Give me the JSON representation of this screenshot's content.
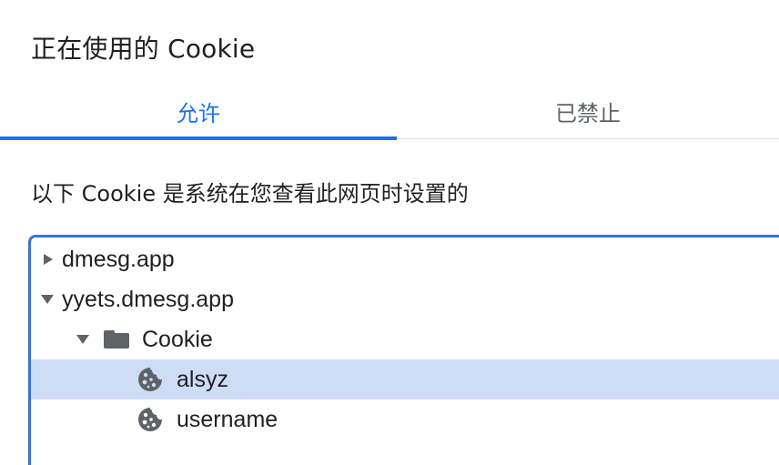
{
  "dialog": {
    "title": "正在使用的 Cookie",
    "tabs": [
      {
        "label": "允许",
        "active": true
      },
      {
        "label": "已禁止",
        "active": false
      }
    ],
    "description": "以下 Cookie 是系统在您查看此网页时设置的"
  },
  "tree": {
    "items": [
      {
        "label": "dmesg.app",
        "level": 0,
        "expanded": false,
        "icon": "triangle-right-icon"
      },
      {
        "label": "yyets.dmesg.app",
        "level": 0,
        "expanded": true,
        "icon": "triangle-down-icon"
      },
      {
        "label": "Cookie",
        "level": 1,
        "expanded": true,
        "icon": "folder-icon"
      },
      {
        "label": "alsyz",
        "level": 2,
        "selected": true,
        "icon": "cookie-icon"
      },
      {
        "label": "username",
        "level": 2,
        "selected": false,
        "icon": "cookie-icon"
      }
    ]
  },
  "colors": {
    "accent": "#1a73e8",
    "selected_row": "#cfdcf5",
    "tree_border": "#3b73d3",
    "icon_gray": "#5f6368"
  }
}
